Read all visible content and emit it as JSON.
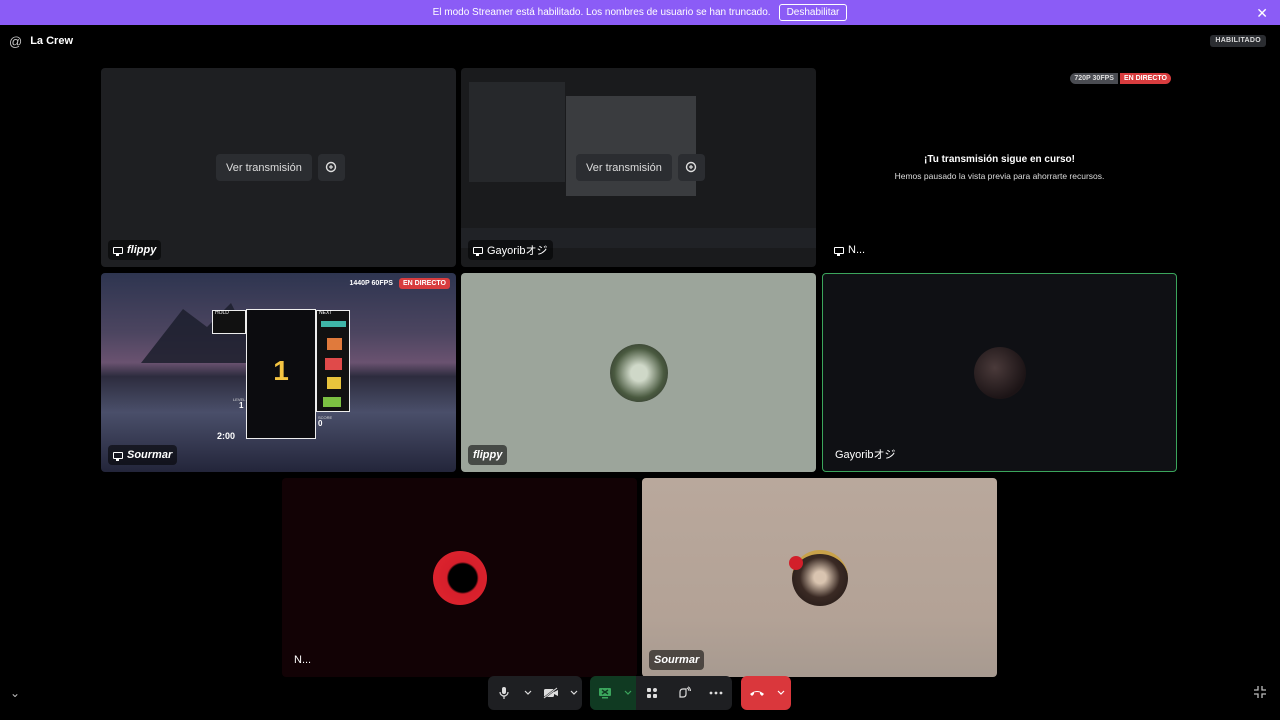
{
  "banner": {
    "message": "El modo Streamer está habilitado. Los nombres de usuario se han truncado.",
    "button": "Deshabilitar",
    "color": "#8b5cf6"
  },
  "header": {
    "server": "La Crew",
    "badge": "HABILITADO"
  },
  "tiles": {
    "t1": {
      "name": "flippy",
      "watch": "Ver transmisión"
    },
    "t2": {
      "name": "Gayoribオジ",
      "watch": "Ver transmisión"
    },
    "t3": {
      "name": "N...",
      "paused_title": "¡Tu transmisión sigue en curso!",
      "paused_sub": "Hemos pausado la vista previa para ahorrarte recursos.",
      "quality": "720P 30FPS",
      "live": "EN DIRECTO"
    },
    "t4": {
      "name": "Sourmar",
      "quality": "1440P 60FPS",
      "live": "EN DIRECTO",
      "game_counter": "1",
      "hold": "HOLD",
      "next": "NEXT",
      "time": "2:00",
      "level_label": "LEVEL",
      "level_value": "1",
      "score_label": "SCORE",
      "score_value": "0"
    },
    "t5": {
      "name": "flippy"
    },
    "t6": {
      "name": "Gayoribオジ"
    },
    "t7": {
      "name": "N..."
    },
    "t8": {
      "name": "Sourmar"
    }
  },
  "colors": {
    "accent": "#8b5cf6",
    "live": "#d83c3e",
    "speaking": "#3ba55c",
    "hangup": "#da373c",
    "stream_green": "#248046"
  }
}
